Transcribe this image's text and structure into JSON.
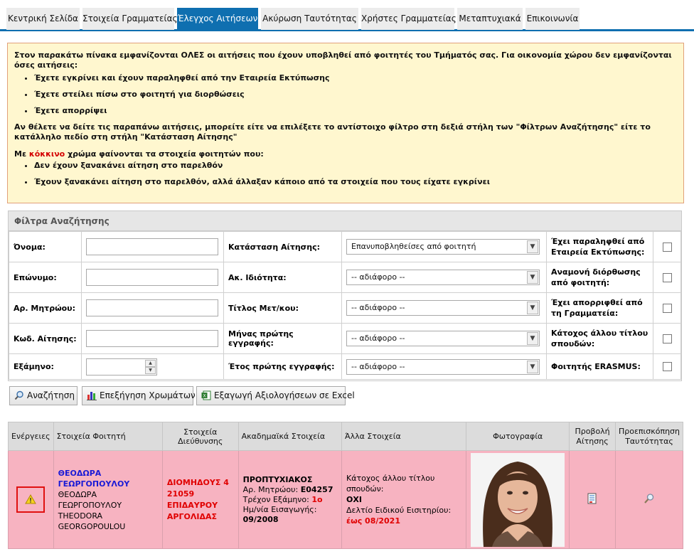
{
  "tabs": [
    {
      "label": "Κεντρική Σελίδα"
    },
    {
      "label": "Στοιχεία Γραμματείας"
    },
    {
      "label": "Έλεγχος Αιτήσεων"
    },
    {
      "label": "Ακύρωση Ταυτότητας"
    },
    {
      "label": "Χρήστες Γραμματείας"
    },
    {
      "label": "Μεταπτυχιακά"
    },
    {
      "label": "Επικοινωνία"
    }
  ],
  "active_tab": "Έλεγχος Αιτήσεων",
  "notice": {
    "intro": "Στον παρακάτω πίνακα εμφανίζονται ΟΛΕΣ οι αιτήσεις που έχουν υποβληθεί από φοιτητές του Τμήματός σας. Για οικονομία χώρου δεν εμφανίζονται όσες αιτήσεις:",
    "hidden_items": [
      "Έχετε εγκρίνει και έχουν παραληφθεί από την Εταιρεία Εκτύπωσης",
      "Έχετε στείλει πίσω στο φοιτητή για διορθώσεις",
      "Έχετε απορρίψει"
    ],
    "filter_text": "Αν θέλετε να δείτε τις παραπάνω αιτήσεις, μπορείτε είτε να επιλέξετε το αντίστοιχο φίλτρο στη δεξιά στήλη των \"Φίλτρων Αναζήτησης\" είτε το κατάλληλο πεδίο στη στήλη \"Κατάσταση Αίτησης\"",
    "red_prefix": "Με ",
    "red_word": "κόκκινο",
    "red_suffix": " χρώμα φαίνονται τα στοιχεία φοιτητών που:",
    "red_items": [
      "Δεν έχουν ξανακάνει αίτηση στο παρελθόν",
      "Έχουν ξανακάνει αίτηση στο παρελθόν, αλλά άλλαξαν κάποιο από τα στοιχεία που τους είχατε εγκρίνει"
    ]
  },
  "filters": {
    "title": "Φίλτρα Αναζήτησης",
    "name_label": "Όνομα:",
    "surname_label": "Επώνυμο:",
    "registry_label": "Αρ. Μητρώου:",
    "code_label": "Κωδ. Αίτησης:",
    "semester_label": "Εξάμηνο:",
    "status_label": "Κατάσταση Αίτησης:",
    "status_value": "Επανυποβληθείσες από φοιτητή",
    "academic_label": "Ακ. Ιδιότητα:",
    "academic_value": "-- αδιάφορο --",
    "postgrad_label": "Τίτλος Μετ/κου:",
    "postgrad_value": "-- αδιάφορο --",
    "month_label": "Μήνας πρώτης εγγραφής:",
    "month_value": "-- αδιάφορο --",
    "year_label": "Έτος πρώτης εγγραφής:",
    "year_value": "-- αδιάφορο --",
    "cb_received": "Έχει παραληφθεί από Εταιρεία Εκτύπωσης:",
    "cb_waiting": "Αναμονή διόρθωσης από φοιτητή:",
    "cb_rejected": "Έχει απορριφθεί από τη Γραμματεία:",
    "cb_other_title": "Κάτοχος άλλου τίτλου σπουδών:",
    "cb_erasmus": "Φοιτητής ERASMUS:"
  },
  "buttons": {
    "search": "Αναζήτηση",
    "colors": "Επεξήγηση Χρωμάτων",
    "excel": "Εξαγωγή Αξιολογήσεων σε Excel"
  },
  "results": {
    "headers": [
      "Ενέργειες",
      "Στοιχεία Φοιτητή",
      "Στοιχεία Διεύθυνσης",
      "Ακαδημαϊκά Στοιχεία",
      "Άλλα Στοιχεία",
      "Φωτογραφία",
      "Προβολή Αίτησης",
      "Προεπισκόπηση Ταυτότητας"
    ],
    "row": {
      "name_first": "ΘΕΟΔΩΡΑ",
      "name_last": "ΓΕΩΡΓΟΠΟΥΛΟΥ",
      "name_full": "ΘΕΟΔΩΡΑ ΓΕΩΡΓΟΠΟΥΛΟΥ",
      "name_latin_first": "THEODORA",
      "name_latin_last": "GEORGOPOULOU",
      "address_line1": "ΔΙΟΜΗΔΟΥΣ 4",
      "address_line2": "21059",
      "address_line3": "ΕΠΙΔΑΥΡΟΥ",
      "address_line4": "ΑΡΓΟΛΙΔΑΣ",
      "level": "ΠΡΟΠΤΥΧΙΑΚΟΣ",
      "registry_label": "Αρ. Μητρώου: ",
      "registry_value": "Ε04257",
      "semester_label": "Τρέχον Εξάμηνο: ",
      "semester_value": "1ο",
      "entry_label": "Ημ/νία Εισαγωγής:",
      "entry_value": "09/2008",
      "other_title_label": "Κάτοχος άλλου τίτλου σπουδών:",
      "other_title_value": "ΟΧΙ",
      "ticket_label": "Δελτίο Ειδικού Εισιτηρίου:",
      "ticket_value": "έως 08/2021"
    }
  },
  "colors": {
    "tab_active": "#0f6fb0",
    "notice_bg": "#fff7cf",
    "row_bg": "#f7b3c1",
    "red_text": "#e00000",
    "blue_text": "#1a1ad6"
  }
}
